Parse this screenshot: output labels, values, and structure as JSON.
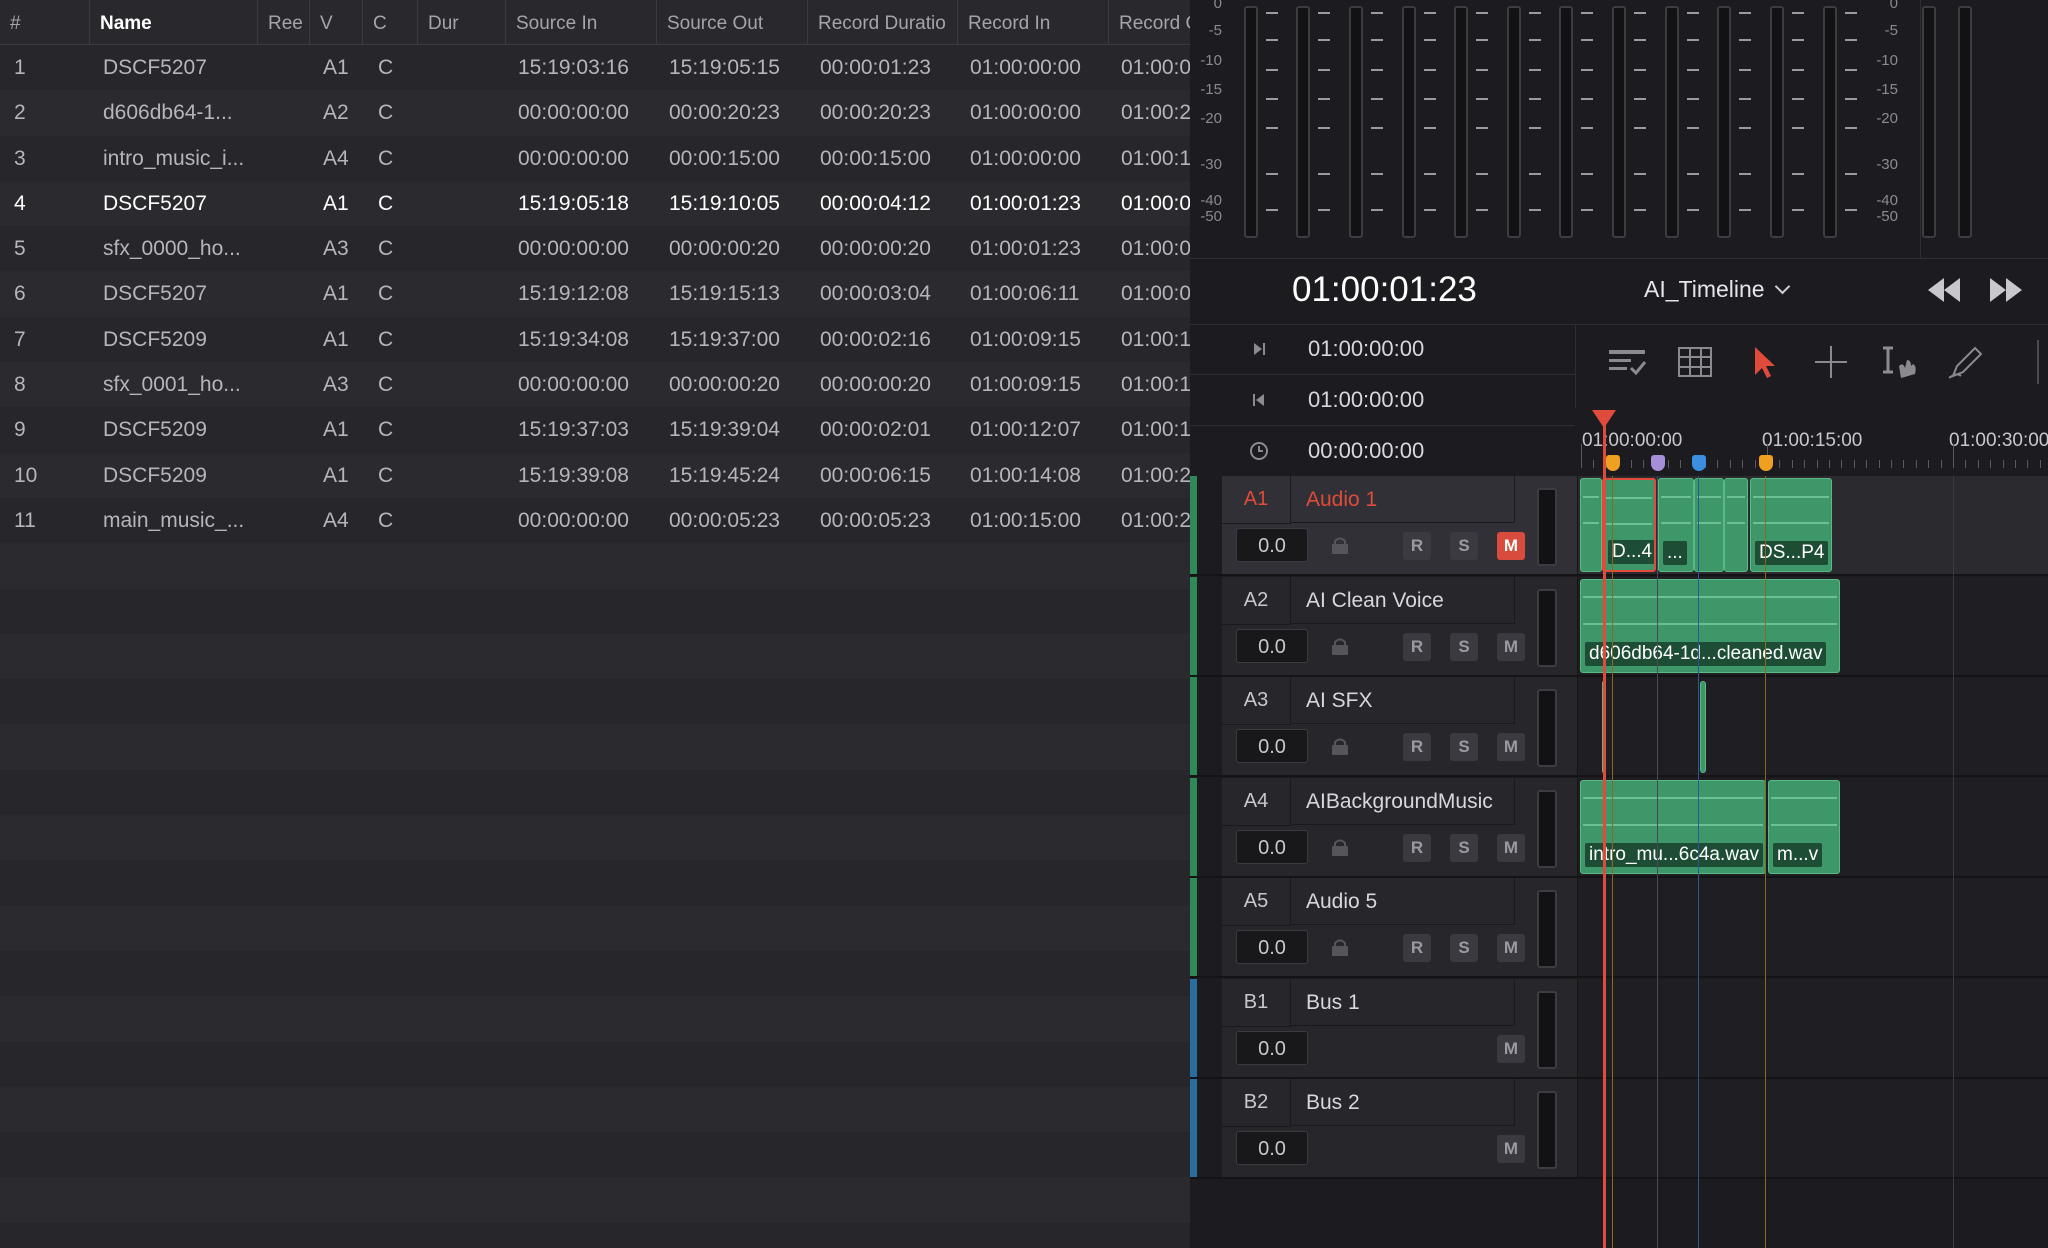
{
  "edl": {
    "columns": [
      "#",
      "Name",
      "Ree",
      "V",
      "C",
      "Dur",
      "Source In",
      "Source Out",
      "Record Duratio",
      "Record In",
      "Record O"
    ],
    "rows": [
      {
        "n": "1",
        "name": "DSCF5207",
        "v": "A1",
        "c": "C",
        "src_in": "15:19:03:16",
        "src_out": "15:19:05:15",
        "rec_dur": "00:00:01:23",
        "rec_in": "01:00:00:00",
        "rec_out": "01:00:0"
      },
      {
        "n": "2",
        "name": "d606db64-1...",
        "v": "A2",
        "c": "C",
        "src_in": "00:00:00:00",
        "src_out": "00:00:20:23",
        "rec_dur": "00:00:20:23",
        "rec_in": "01:00:00:00",
        "rec_out": "01:00:2"
      },
      {
        "n": "3",
        "name": "intro_music_i...",
        "v": "A4",
        "c": "C",
        "src_in": "00:00:00:00",
        "src_out": "00:00:15:00",
        "rec_dur": "00:00:15:00",
        "rec_in": "01:00:00:00",
        "rec_out": "01:00:1"
      },
      {
        "n": "4",
        "name": "DSCF5207",
        "v": "A1",
        "c": "C",
        "src_in": "15:19:05:18",
        "src_out": "15:19:10:05",
        "rec_dur": "00:00:04:12",
        "rec_in": "01:00:01:23",
        "rec_out": "01:00:0"
      },
      {
        "n": "5",
        "name": "sfx_0000_ho...",
        "v": "A3",
        "c": "C",
        "src_in": "00:00:00:00",
        "src_out": "00:00:00:20",
        "rec_dur": "00:00:00:20",
        "rec_in": "01:00:01:23",
        "rec_out": "01:00:0"
      },
      {
        "n": "6",
        "name": "DSCF5207",
        "v": "A1",
        "c": "C",
        "src_in": "15:19:12:08",
        "src_out": "15:19:15:13",
        "rec_dur": "00:00:03:04",
        "rec_in": "01:00:06:11",
        "rec_out": "01:00:0"
      },
      {
        "n": "7",
        "name": "DSCF5209",
        "v": "A1",
        "c": "C",
        "src_in": "15:19:34:08",
        "src_out": "15:19:37:00",
        "rec_dur": "00:00:02:16",
        "rec_in": "01:00:09:15",
        "rec_out": "01:00:1"
      },
      {
        "n": "8",
        "name": "sfx_0001_ho...",
        "v": "A3",
        "c": "C",
        "src_in": "00:00:00:00",
        "src_out": "00:00:00:20",
        "rec_dur": "00:00:00:20",
        "rec_in": "01:00:09:15",
        "rec_out": "01:00:1"
      },
      {
        "n": "9",
        "name": "DSCF5209",
        "v": "A1",
        "c": "C",
        "src_in": "15:19:37:03",
        "src_out": "15:19:39:04",
        "rec_dur": "00:00:02:01",
        "rec_in": "01:00:12:07",
        "rec_out": "01:00:1"
      },
      {
        "n": "10",
        "name": "DSCF5209",
        "v": "A1",
        "c": "C",
        "src_in": "15:19:39:08",
        "src_out": "15:19:45:24",
        "rec_dur": "00:00:06:15",
        "rec_in": "01:00:14:08",
        "rec_out": "01:00:2"
      },
      {
        "n": "11",
        "name": "main_music_...",
        "v": "A4",
        "c": "C",
        "src_in": "00:00:00:00",
        "src_out": "00:00:05:23",
        "rec_dur": "00:00:05:23",
        "rec_in": "01:00:15:00",
        "rec_out": "01:00:2"
      }
    ],
    "selected_row_index": 3
  },
  "meters": {
    "left_labels": [
      "0",
      "-5",
      "-10",
      "-15",
      "-20",
      "-30",
      "-40",
      "-50"
    ],
    "right_labels": [
      "0",
      "-5",
      "-10",
      "-15",
      "-20",
      "-30",
      "-40",
      "-50"
    ]
  },
  "transport": {
    "timecode": "01:00:01:23",
    "timeline_name": "AI_Timeline",
    "icons": [
      "rewind-icon",
      "fast-forward-icon"
    ]
  },
  "tc_panel": {
    "in": "01:00:00:00",
    "out": "01:00:00:00",
    "duration": "00:00:00:00"
  },
  "toolbar": {
    "icons": [
      "edit-index-icon",
      "grid-icon",
      "pointer-icon",
      "range-select-icon",
      "edit-select-icon",
      "pencil-icon"
    ]
  },
  "ruler": {
    "labels": [
      "01:00:00:00",
      "01:00:15:00",
      "01:00:30:00"
    ]
  },
  "tracks": [
    {
      "id": "A1",
      "name": "Audio 1",
      "vol": "0.0",
      "r": "R",
      "s": "S",
      "m": "M",
      "muted": true,
      "selected": true,
      "color": "#2f8a57"
    },
    {
      "id": "A2",
      "name": "AI Clean Voice",
      "vol": "0.0",
      "r": "R",
      "s": "S",
      "m": "M",
      "muted": false,
      "selected": false,
      "color": "#2f8a57"
    },
    {
      "id": "A3",
      "name": "AI SFX",
      "vol": "0.0",
      "r": "R",
      "s": "S",
      "m": "M",
      "muted": false,
      "selected": false,
      "color": "#2f8a57"
    },
    {
      "id": "A4",
      "name": "AIBackgroundMusic",
      "vol": "0.0",
      "r": "R",
      "s": "S",
      "m": "M",
      "muted": false,
      "selected": false,
      "color": "#2f8a57"
    },
    {
      "id": "A5",
      "name": "Audio 5",
      "vol": "0.0",
      "r": "R",
      "s": "S",
      "m": "M",
      "muted": false,
      "selected": false,
      "color": "#2f8a57"
    },
    {
      "id": "B1",
      "name": "Bus 1",
      "vol": "0.0",
      "m": "M",
      "muted": false,
      "selected": false,
      "bus": true,
      "color": "#2a6ea0"
    },
    {
      "id": "B2",
      "name": "Bus 2",
      "vol": "0.0",
      "m": "M",
      "muted": false,
      "selected": false,
      "bus": true,
      "color": "#2a6ea0"
    }
  ],
  "clips": {
    "a1_labels": [
      "D...4",
      "...",
      "DS...P4"
    ],
    "a2_label": "d606db64-1d...cleaned.wav",
    "a4_labels": [
      "intro_mu...6c4a.wav",
      "m...v"
    ]
  },
  "colors": {
    "accent_red": "#e04b3b",
    "clip_green": "#3d9768",
    "marker_orange": "#f0a020",
    "marker_purple": "#a58fd8",
    "marker_blue": "#3a8fe0"
  }
}
